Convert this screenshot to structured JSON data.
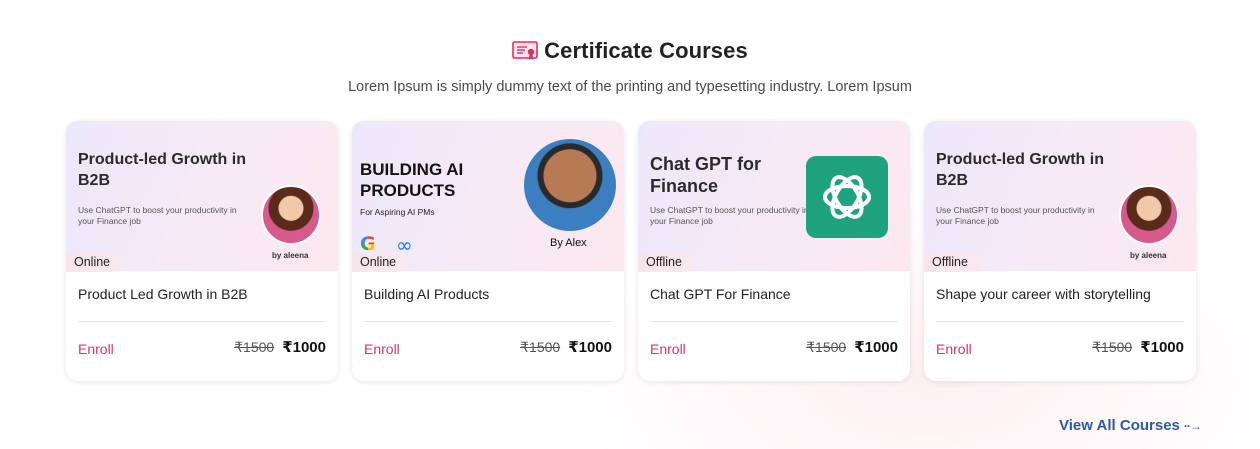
{
  "header": {
    "title": "Certificate Courses",
    "subtitle": "Lorem Ipsum is simply dummy text of the printing and typesetting industry. Lorem Ipsum",
    "icon": "certificate-icon"
  },
  "currency_symbol": "₹",
  "cards": [
    {
      "banner_title": "Product-led Growth in B2B",
      "banner_desc": "Use ChatGPT to boost your productivity in your Finance job",
      "instructor": "by aleena",
      "mode": "Online",
      "name": "Product Led Growth in B2B",
      "enroll": "Enroll",
      "old_price": "₹1500",
      "new_price": "₹1000"
    },
    {
      "banner_title": "BUILDING AI PRODUCTS",
      "banner_desc": "For Aspiring AI PMs",
      "instructor": "By Alex",
      "mode": "Online",
      "name": "Building AI Products",
      "enroll": "Enroll",
      "old_price": "₹1500",
      "new_price": "₹1000"
    },
    {
      "banner_title": "Chat GPT for Finance",
      "banner_desc": "Use ChatGPT to boost your productivity in your Finance job",
      "mode": "Offline",
      "name": "Chat GPT For Finance",
      "enroll": "Enroll",
      "old_price": "₹1500",
      "new_price": "₹1000"
    },
    {
      "banner_title": "Product-led Growth in B2B",
      "banner_desc": "Use ChatGPT to boost your productivity in your Finance job",
      "instructor": "by aleena",
      "mode": "Offline",
      "name": "Shape your career with storytelling",
      "enroll": "Enroll",
      "old_price": "₹1500",
      "new_price": "₹1000"
    }
  ],
  "view_all": "View All Courses",
  "colors": {
    "accent": "#e0306b",
    "link": "#2c5aa8",
    "chatgpt_green": "#1fa37f"
  }
}
